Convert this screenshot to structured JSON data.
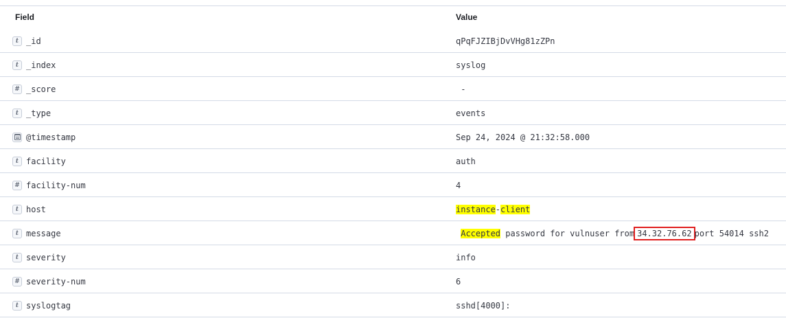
{
  "header": {
    "field_label": "Field",
    "value_label": "Value"
  },
  "rows": [
    {
      "type": "t",
      "field": "_id",
      "value": "qPqFJZIBjDvVHg81zZPn"
    },
    {
      "type": "t",
      "field": "_index",
      "value": "syslog"
    },
    {
      "type": "#",
      "field": "_score",
      "value": " -"
    },
    {
      "type": "t",
      "field": "_type",
      "value": "events"
    },
    {
      "type": "date",
      "field": "@timestamp",
      "value": "Sep 24, 2024 @ 21:32:58.000"
    },
    {
      "type": "t",
      "field": "facility",
      "value": "auth"
    },
    {
      "type": "#",
      "field": "facility-num",
      "value": "4"
    },
    {
      "type": "t",
      "field": "host",
      "value_parts": {
        "p1": "instance",
        "sep": "-",
        "p2": "client"
      }
    },
    {
      "type": "t",
      "field": "message",
      "value_parts": {
        "lead": " ",
        "hl": "Accepted",
        "mid": " password for vulnuser from",
        "boxed": "34.32.76.62",
        "tail": "port 54014 ssh2"
      }
    },
    {
      "type": "t",
      "field": "severity",
      "value": "info"
    },
    {
      "type": "#",
      "field": "severity-num",
      "value": "6"
    },
    {
      "type": "t",
      "field": "syslogtag",
      "value": "sshd[4000]:"
    }
  ],
  "colors": {
    "highlight": "#ffff00",
    "annotation_box": "#e01e1e",
    "border": "#d3dae6"
  },
  "icons": {
    "t": "string-type-icon",
    "#": "number-type-icon",
    "date": "calendar-type-icon"
  }
}
